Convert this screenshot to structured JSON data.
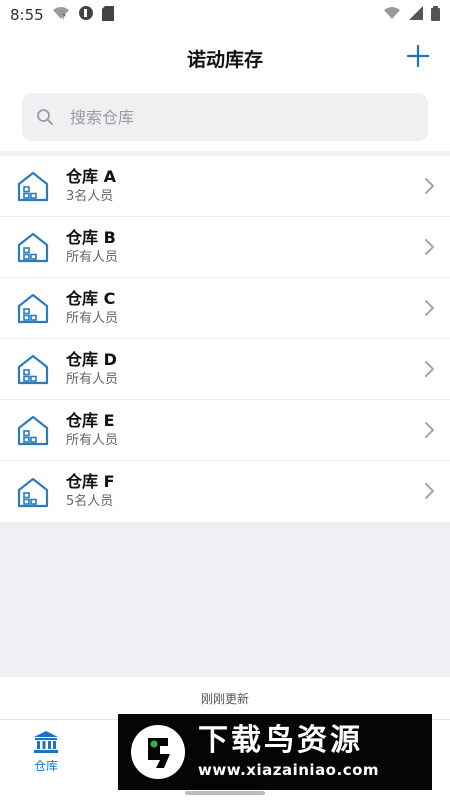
{
  "status_bar": {
    "time": "8:55"
  },
  "header": {
    "title": "诺动库存"
  },
  "search": {
    "placeholder": "搜索仓库"
  },
  "warehouses": [
    {
      "name": "仓库 A",
      "members": "3名人员"
    },
    {
      "name": "仓库 B",
      "members": "所有人员"
    },
    {
      "name": "仓库 C",
      "members": "所有人员"
    },
    {
      "name": "仓库 D",
      "members": "所有人员"
    },
    {
      "name": "仓库 E",
      "members": "所有人员"
    },
    {
      "name": "仓库 F",
      "members": "5名人员"
    }
  ],
  "footer": {
    "update_text": "刚刚更新"
  },
  "tabbar": {
    "active_tab_label": "仓库"
  },
  "watermark": {
    "brand": "下载鸟资源",
    "url": "www.xiazainiao.com"
  },
  "colors": {
    "accent": "#1b73c5",
    "icon_blue": "#2b7bbf"
  }
}
